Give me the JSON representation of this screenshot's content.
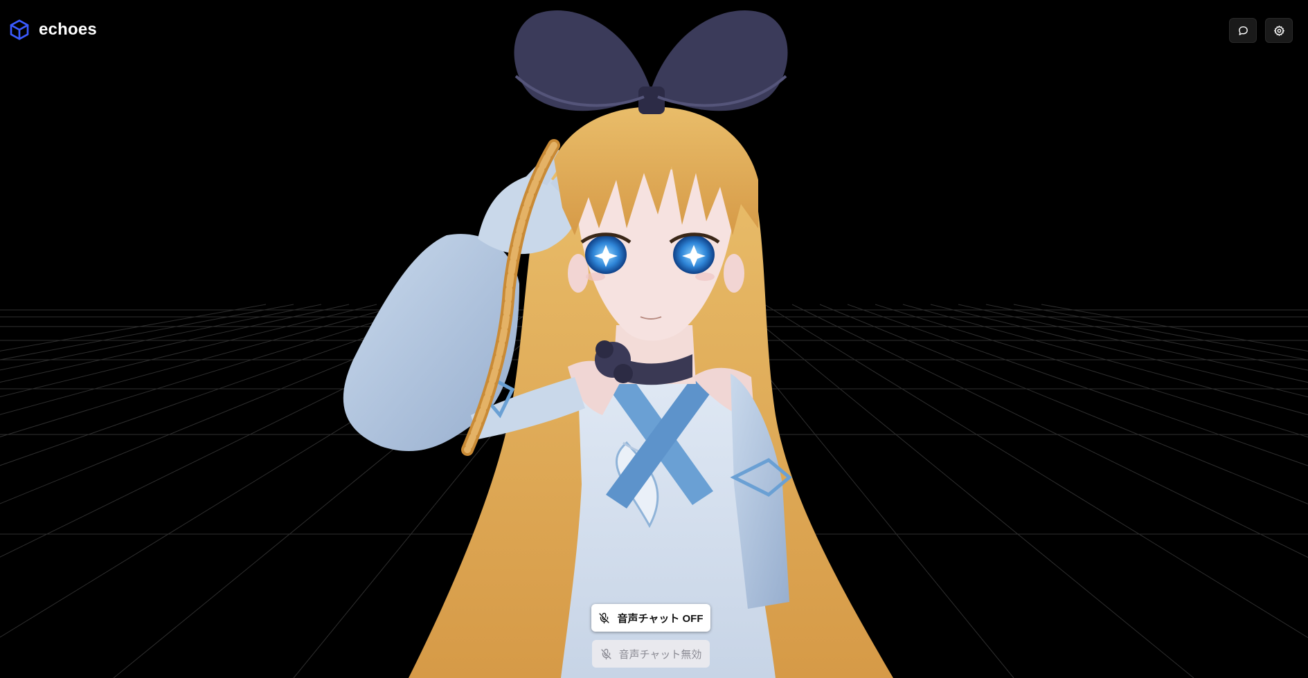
{
  "app": {
    "name": "echoes",
    "logo_icon": "cube-icon",
    "accent_color": "#3b5bff"
  },
  "header": {
    "chat_button_icon": "chat-bubble-icon",
    "settings_button_icon": "gear-icon"
  },
  "voice": {
    "toggle_label": "音声チャット OFF",
    "toggle_icon": "mic-off-icon",
    "status_label": "音声チャット無効",
    "status_icon": "mic-off-icon"
  },
  "scene": {
    "background_color": "#000000",
    "grid_color": "#2b2b2b",
    "avatar_description_icon": "avatar-model"
  }
}
